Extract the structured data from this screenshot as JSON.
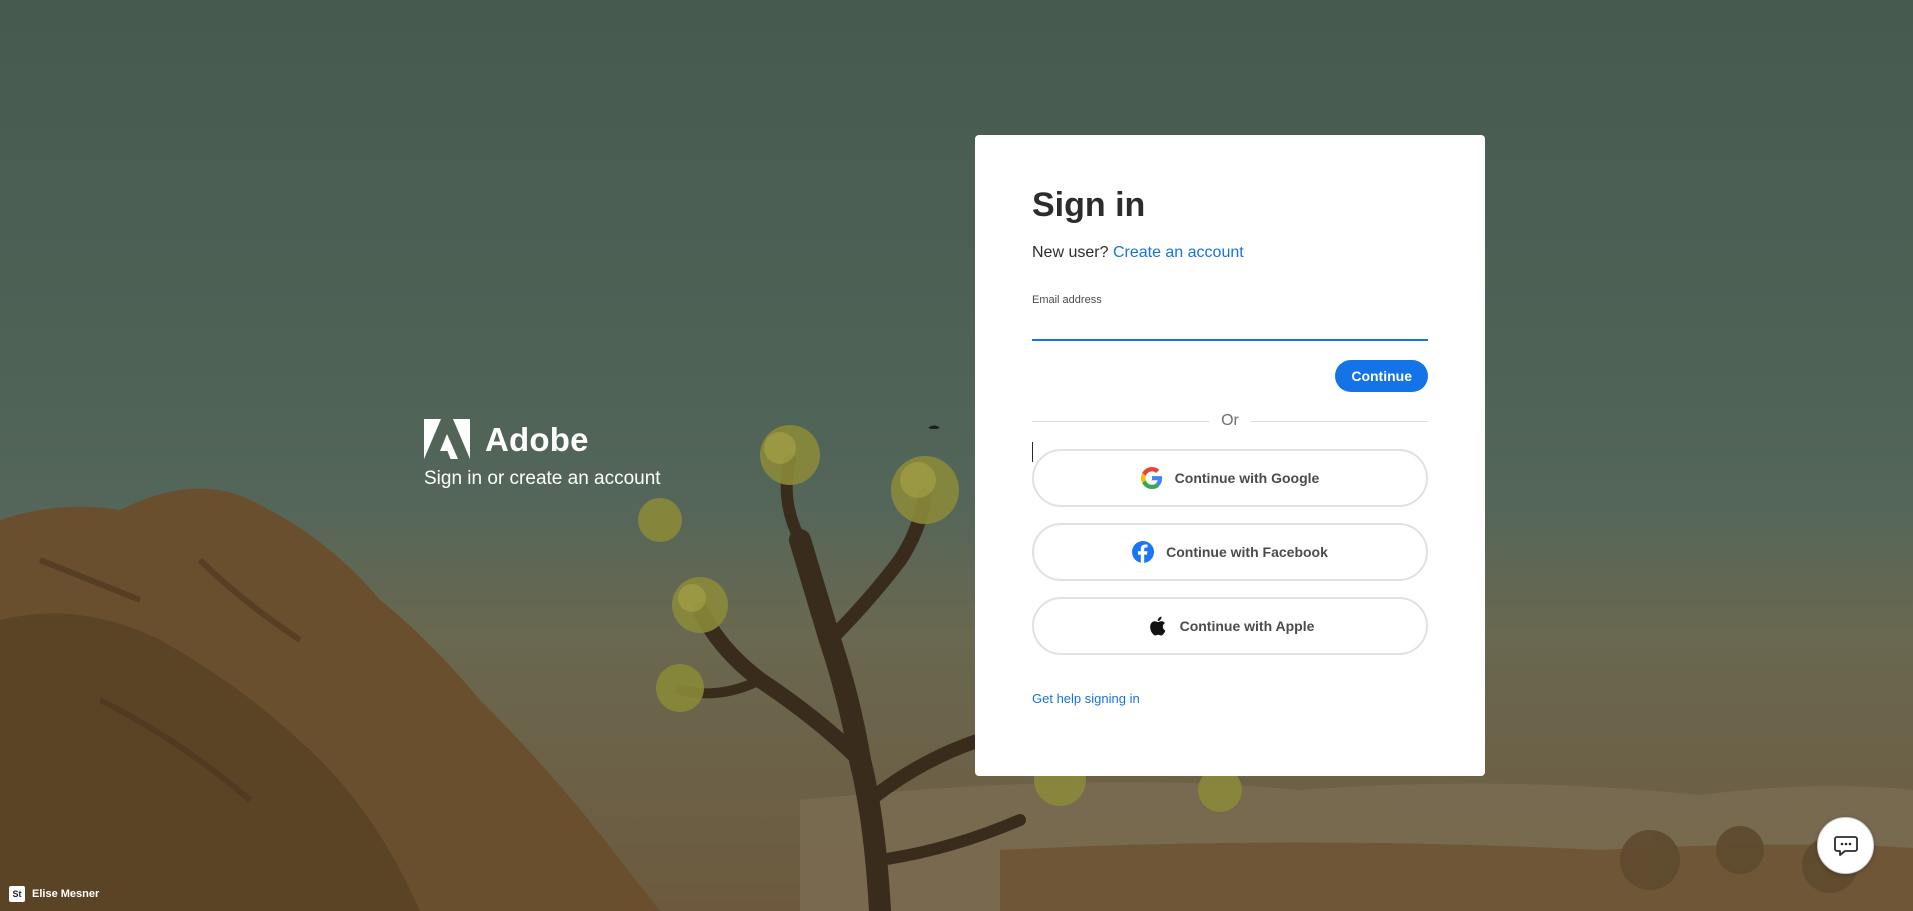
{
  "brand": {
    "name": "Adobe",
    "tagline": "Sign in or create an account"
  },
  "signin": {
    "title": "Sign in",
    "new_user_prompt": "New user?",
    "create_account_link": "Create an account",
    "email_label": "Email address",
    "email_value": "",
    "continue_label": "Continue",
    "or_label": "Or",
    "google_label": "Continue with Google",
    "facebook_label": "Continue with Facebook",
    "apple_label": "Continue with Apple",
    "help_link": "Get help signing in"
  },
  "footer": {
    "badge": "St",
    "credit": "Elise Mesner"
  },
  "icons": {
    "chat": "chat-icon",
    "google": "google-icon",
    "facebook": "facebook-icon",
    "apple": "apple-icon",
    "adobe": "adobe-logo"
  },
  "colors": {
    "accent": "#1473e6",
    "facebook": "#1877f2"
  }
}
